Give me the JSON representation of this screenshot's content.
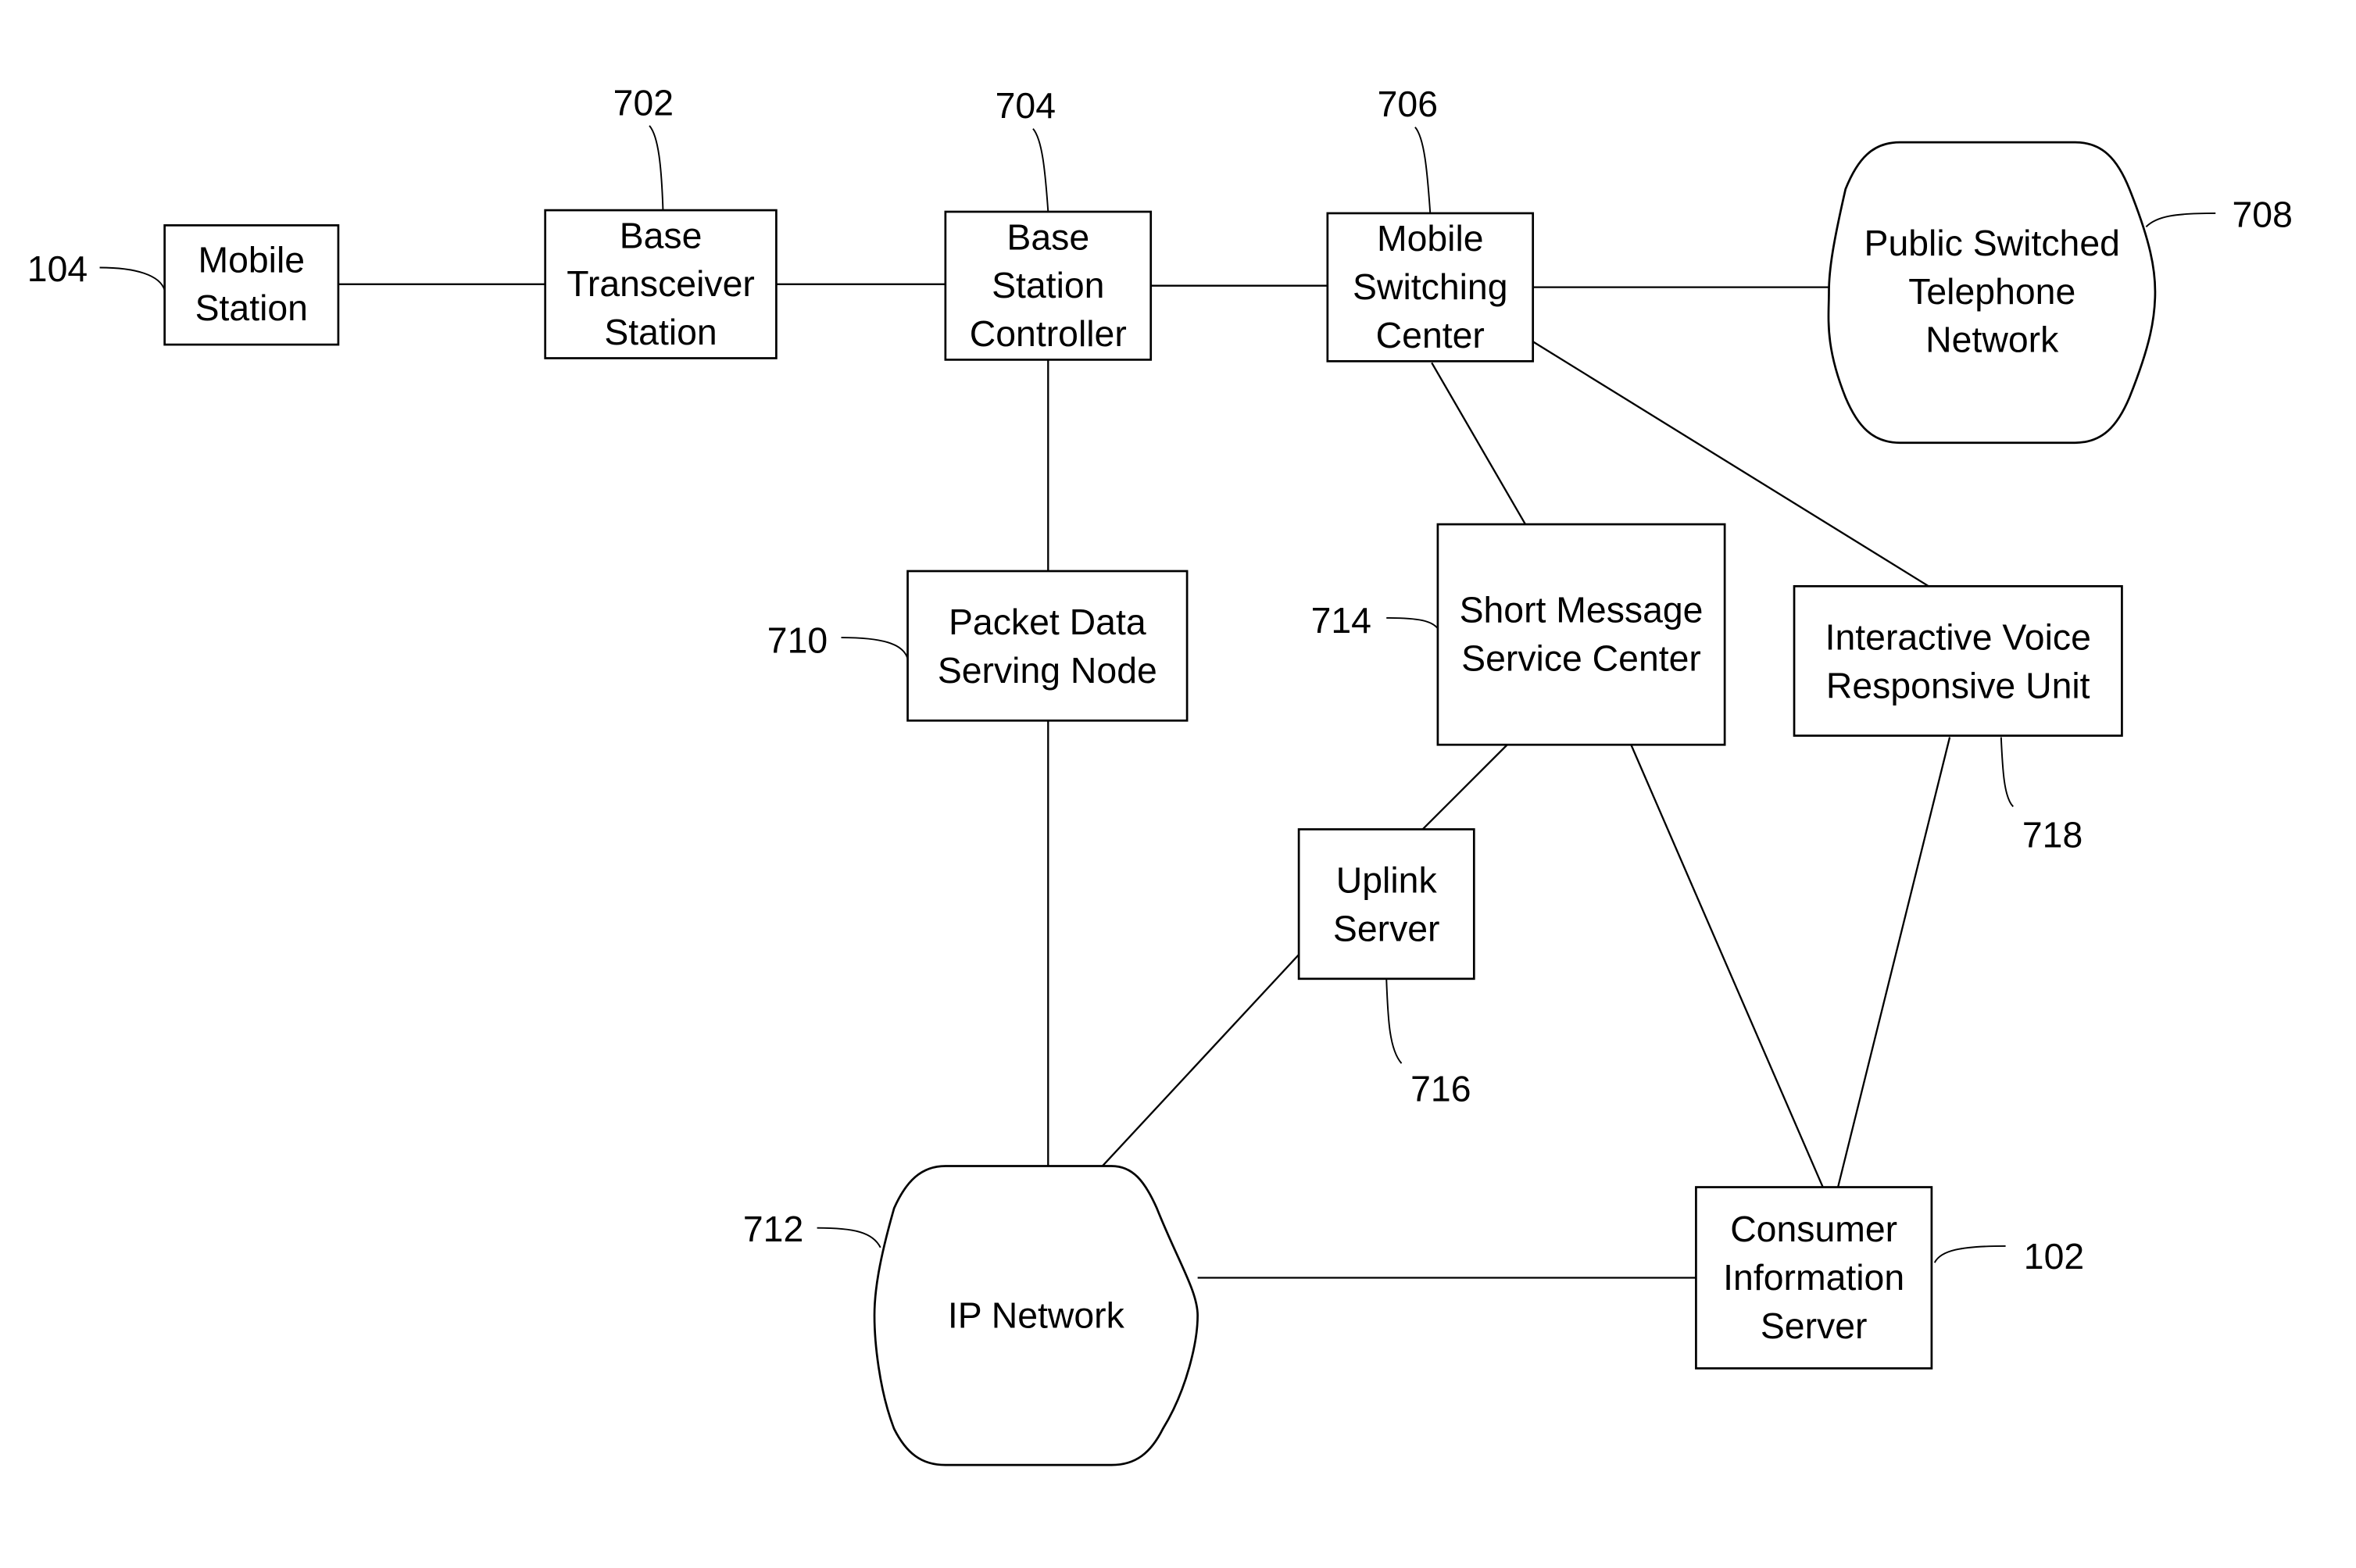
{
  "diagram": {
    "type": "network-block-diagram",
    "nodes": [
      {
        "id": "mobile_station",
        "ref": "104",
        "shape": "box",
        "lines": [
          "Mobile",
          "Station"
        ]
      },
      {
        "id": "bts",
        "ref": "702",
        "shape": "box",
        "lines": [
          "Base",
          "Transceiver",
          "Station"
        ]
      },
      {
        "id": "bsc",
        "ref": "704",
        "shape": "box",
        "lines": [
          "Base",
          "Station",
          "Controller"
        ]
      },
      {
        "id": "msc",
        "ref": "706",
        "shape": "box",
        "lines": [
          "Mobile",
          "Switching",
          "Center"
        ]
      },
      {
        "id": "pstn",
        "ref": "708",
        "shape": "cloud",
        "lines": [
          "Public Switched",
          "Telephone",
          "Network"
        ]
      },
      {
        "id": "pdsn",
        "ref": "710",
        "shape": "box",
        "lines": [
          "Packet Data",
          "Serving Node"
        ]
      },
      {
        "id": "ip_network",
        "ref": "712",
        "shape": "cloud",
        "lines": [
          "IP Network"
        ]
      },
      {
        "id": "smsc",
        "ref": "714",
        "shape": "box",
        "lines": [
          "Short Message",
          "Service Center"
        ]
      },
      {
        "id": "uplink",
        "ref": "716",
        "shape": "box",
        "lines": [
          "Uplink",
          "Server"
        ]
      },
      {
        "id": "ivr",
        "ref": "718",
        "shape": "box",
        "lines": [
          "Interactive Voice",
          "Responsive Unit"
        ]
      },
      {
        "id": "cis",
        "ref": "102",
        "shape": "box",
        "lines": [
          "Consumer",
          "Information",
          "Server"
        ]
      }
    ],
    "edges": [
      [
        "mobile_station",
        "bts"
      ],
      [
        "bts",
        "bsc"
      ],
      [
        "bsc",
        "msc"
      ],
      [
        "msc",
        "pstn"
      ],
      [
        "bsc",
        "pdsn"
      ],
      [
        "pdsn",
        "ip_network"
      ],
      [
        "msc",
        "smsc"
      ],
      [
        "msc",
        "ivr"
      ],
      [
        "smsc",
        "uplink"
      ],
      [
        "uplink",
        "ip_network"
      ],
      [
        "smsc",
        "cis"
      ],
      [
        "ivr",
        "cis"
      ],
      [
        "ip_network",
        "cis"
      ]
    ]
  }
}
